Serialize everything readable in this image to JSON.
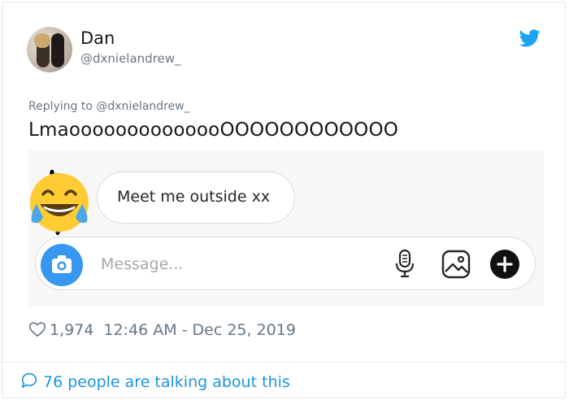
{
  "author": {
    "name": "Dan",
    "handle": "@dxnielandrew_"
  },
  "brand": {
    "icon": "twitter-bird-icon",
    "color": "#1da1f2"
  },
  "reply": {
    "label": "Replying to @dxnielandrew_"
  },
  "tweet": {
    "text": "LmaoooooooooooooOOOOOOOOOOOO"
  },
  "screenshot": {
    "message_bubble": "Meet me outside xx",
    "input_placeholder": "Message...",
    "icons": [
      "laughing-tears-emoji-icon",
      "camera-icon",
      "microphone-icon",
      "gallery-icon",
      "plus-icon"
    ],
    "camera_color": "#3897f0"
  },
  "meta": {
    "likes": "1,974",
    "timestamp": "12:46 AM - Dec 25, 2019"
  },
  "footer": {
    "talking": "76 people are talking about this",
    "link_color": "#1b95e0"
  }
}
